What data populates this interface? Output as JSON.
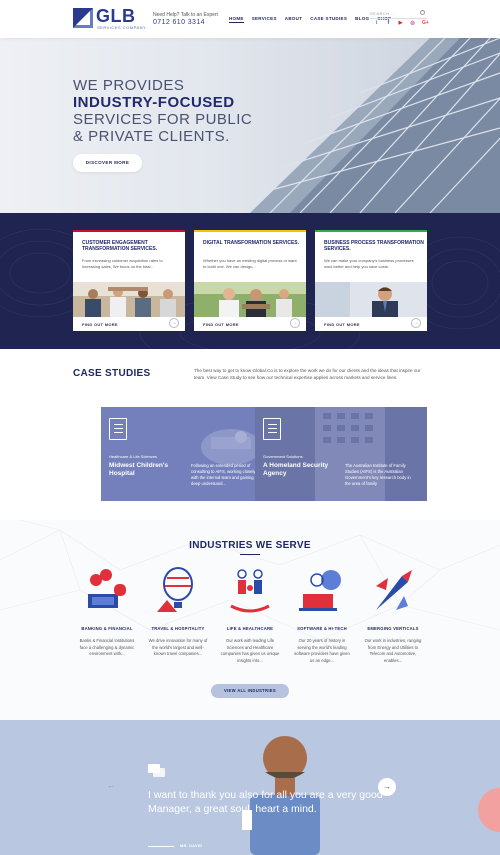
{
  "header": {
    "logo_text": "GLB",
    "logo_sub": "SERVICES COMPANY",
    "help_text": "Need Help? Talk to an Expert",
    "phone": "0712 610 3314",
    "nav": [
      "HOME",
      "SERVICES",
      "ABOUT",
      "CASE STUDIES",
      "BLOG",
      "SHOP"
    ],
    "search_placeholder": "SEARCH ...",
    "socials": [
      "twitter-icon",
      "facebook-icon",
      "youtube-icon",
      "instagram-icon",
      "google-plus-icon"
    ]
  },
  "hero": {
    "line1": "WE PROVIDES",
    "line2": "INDUSTRY-FOCUSED",
    "line3": "SERVICES FOR PUBLIC",
    "line4": "& PRIVATE CLIENTS.",
    "button": "DISCOVER MORE"
  },
  "services": [
    {
      "title": "CUSTOMER ENGAGEMENT TRANSFORMATION SERVICES.",
      "desc": "From increasing customer acquisition rates to increasing sales, We focus on the total...",
      "link": "FIND OUT MORE",
      "color": "#c8102e"
    },
    {
      "title": "DIGITAL TRANSFORMATION SERVICES.",
      "desc": "Whether you have an existing digital process or want to build one. We can design...",
      "link": "FIND OUT MORE",
      "color": "#f2c300"
    },
    {
      "title": "BUSINESS PROCESS TRANSFORMATION SERVICES.",
      "desc": "We can make your company's business processes work better and help you save costs.",
      "link": "FIND OUT MORE",
      "color": "#2fae49"
    }
  ],
  "case_studies": {
    "title": "CASE STUDIES",
    "desc": "The best way to get to know Global.Co is to explore the work we do for our clients and the ideas that inspire our team. View Case Study to see how our technical expertise applies across markets and service lines.",
    "items": [
      {
        "tag": "Healthcare & Life Sciences",
        "name": "Midwest Children's Hospital",
        "desc": "Following an extended period of consulting to AIFS, working closely with the internal team and gaining a deep understand..."
      },
      {
        "tag": "Government Solutions",
        "name": "A Homeland Security Agency",
        "desc": "The Australian Institute of Family Studies (AIFS) is the Australian Government's key research body in the area of family"
      }
    ]
  },
  "industries": {
    "title": "INDUSTRIES WE SERVE",
    "items": [
      {
        "title": "BANKING & FINANCIAL",
        "desc": "Banks & Financial Institutions face a challenging & dynamic environment with..."
      },
      {
        "title": "TRAVEL & HOSPITALITY",
        "desc": "We drive innovation for many of the world's largest and well-known travel companies..."
      },
      {
        "title": "LIFE & HEALTHCARE",
        "desc": "Our work with leading Life Sciences and Healthcare companies has given us unique insights into..."
      },
      {
        "title": "SOFTWARE & HI-TECH",
        "desc": "Our 20 years of history in serving the world's leading software providers have given us an edge..."
      },
      {
        "title": "EMERGING VERTICALS",
        "desc": "Our work in industries, ranging from Energy and Utilities to Telecom and Automotive, enables..."
      }
    ],
    "button": "VIEW ALL INDUSTRIES"
  },
  "testimonial": {
    "quote": "I want to thank you also for all you are a very good Manager, a great soul, heart a mind.",
    "name": "MR. DAVID"
  }
}
